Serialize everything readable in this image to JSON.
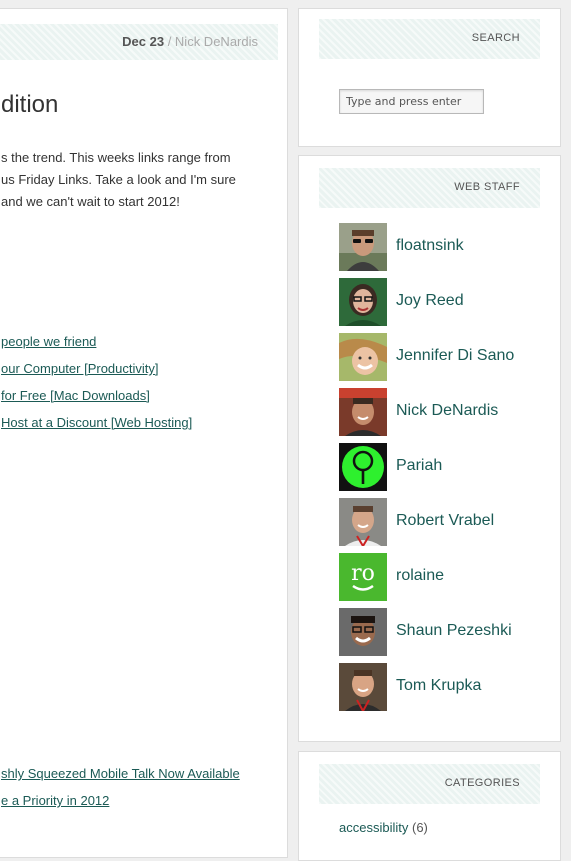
{
  "post": {
    "date": "Dec 23",
    "separator": " / ",
    "author": "Nick DeNardis",
    "title_partial": "dition",
    "paragraph_lines": [
      "s the trend. This weeks links range from",
      "us Friday Links. Take a look and I'm sure",
      " and we can't wait to start 2012!"
    ],
    "links": [
      "people we friend",
      "our Computer [Productivity]",
      "for Free [Mac Downloads]",
      "Host at a Discount [Web Hosting]"
    ],
    "related_links": [
      "shly Squeezed Mobile Talk Now Available",
      "e a Priority in 2012"
    ]
  },
  "search": {
    "heading": "SEARCH",
    "placeholder": "Type and press enter"
  },
  "web_staff": {
    "heading": "WEB STAFF",
    "members": [
      {
        "name": "floatnsink",
        "avatar_icon": "person-sunglasses-icon"
      },
      {
        "name": "Joy Reed",
        "avatar_icon": "person-glasses-icon"
      },
      {
        "name": "Jennifer Di Sano",
        "avatar_icon": "person-smiling-icon"
      },
      {
        "name": "Nick DeNardis",
        "avatar_icon": "person-outdoor-icon"
      },
      {
        "name": "Pariah",
        "avatar_icon": "green-keyhole-logo-icon"
      },
      {
        "name": "Robert Vrabel",
        "avatar_icon": "person-lanyard-icon"
      },
      {
        "name": "rolaine",
        "avatar_icon": "ro-logo-icon",
        "avatar_text": "ro"
      },
      {
        "name": "Shaun Pezeshki",
        "avatar_icon": "person-glasses-smile-icon"
      },
      {
        "name": "Tom Krupka",
        "avatar_icon": "person-lanyard-icon"
      }
    ]
  },
  "categories": {
    "heading": "CATEGORIES",
    "items": [
      {
        "label": "accessibility",
        "count": "(6)"
      }
    ]
  },
  "colors": {
    "link": "#1b5a55",
    "header_band": "#eaf3f1",
    "page_bg": "#efefef"
  }
}
